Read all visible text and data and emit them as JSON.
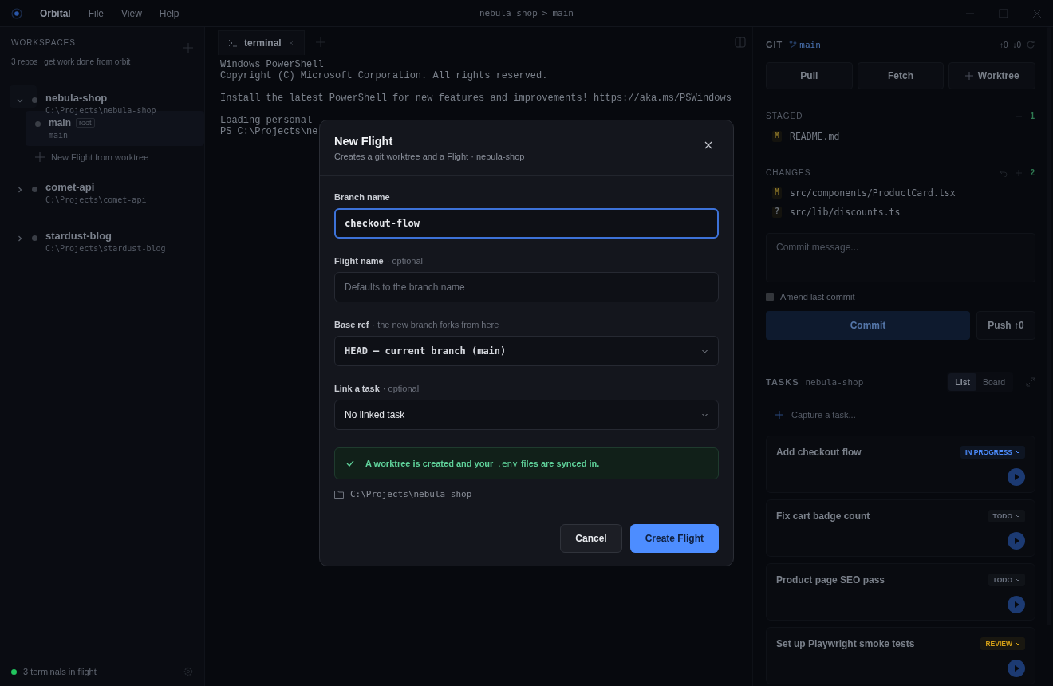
{
  "titlebar": {
    "app_name": "Orbital",
    "menu": [
      "File",
      "View",
      "Help"
    ],
    "repo": "nebula-shop",
    "separator": ">",
    "branch": "main"
  },
  "sidebar": {
    "heading": "WORKSPACES",
    "count": "3 repos",
    "tagline": "get work done from orbit",
    "workspaces": [
      {
        "name": "nebula-shop",
        "path": "C:\\Projects\\nebula-shop",
        "expanded": true,
        "children": [
          {
            "name": "main",
            "badge": "root",
            "branch": "main",
            "selected": true
          }
        ],
        "new_flight": "New Flight from worktree"
      },
      {
        "name": "comet-api",
        "path": "C:\\Projects\\comet-api",
        "expanded": false
      },
      {
        "name": "stardust-blog",
        "path": "C:\\Projects\\stardust-blog",
        "expanded": false
      }
    ],
    "footer": {
      "text": "3 terminals in flight",
      "color": "#22c55e"
    }
  },
  "terminal": {
    "tab": "terminal",
    "blocks": [
      [
        "Windows PowerShell",
        "Copyright (C) Microsoft Corporation. All rights reserved."
      ],
      [
        "Install the latest PowerShell for new features and improvements! https://aka.ms/PSWindows"
      ],
      [
        "Loading personal",
        "PS C:\\Projects\\ne"
      ]
    ]
  },
  "git": {
    "title": "GIT",
    "branch": "main",
    "ahead": "↑0",
    "behind": "↓0",
    "actions": [
      "Pull",
      "Fetch",
      "Worktree"
    ],
    "staged": {
      "label": "STAGED",
      "count": "1",
      "files": [
        {
          "status": "M",
          "path": "README.md"
        }
      ]
    },
    "changes": {
      "label": "CHANGES",
      "count": "2",
      "files": [
        {
          "status": "M",
          "path": "src/components/ProductCard.tsx"
        },
        {
          "status": "?",
          "path": "src/lib/discounts.ts"
        }
      ]
    },
    "commit_placeholder": "Commit message...",
    "amend": {
      "label": "Amend last commit",
      "checked": false
    },
    "commit_button": {
      "label": "Commit",
      "disabled": true
    },
    "push_button": "Push ↑0"
  },
  "tasks": {
    "title": "TASKS",
    "repo": "nebula-shop",
    "views": [
      {
        "label": "List",
        "selected": true
      },
      {
        "label": "Board",
        "selected": false
      }
    ],
    "capture_placeholder": "Capture a task...",
    "items": [
      {
        "title": "Add checkout flow",
        "status": "IN PROGRESS",
        "color": "#4d8dff"
      },
      {
        "title": "Fix cart badge count",
        "status": "TODO",
        "color": "#6b7280"
      },
      {
        "title": "Product page SEO pass",
        "status": "TODO",
        "color": "#6b7280"
      },
      {
        "title": "Set up Playwright smoke tests",
        "status": "REVIEW",
        "color": "#d4a017"
      }
    ]
  },
  "modal": {
    "title": "New Flight",
    "subtitle": "Creates a git worktree and a Flight · nebula-shop",
    "fields": [
      {
        "kind": "text",
        "label": "Branch name",
        "value": "checkout-flow",
        "focused": true
      },
      {
        "kind": "text",
        "label": "Flight name",
        "hint": "· optional",
        "placeholder": "Defaults to the branch name",
        "focused": false
      },
      {
        "kind": "select",
        "label": "Base ref",
        "hint": "· the new branch forks from here",
        "value": "HEAD — current branch (main)",
        "mono": true
      },
      {
        "kind": "select",
        "label": "Link a task",
        "hint": "· optional",
        "value": "No linked task",
        "mono": false
      }
    ],
    "notice": {
      "before": "A worktree is created and your",
      "code": ".env",
      "after": "files are synced in."
    },
    "path": "C:\\Projects\\nebula-shop",
    "buttons": [
      {
        "label": "Cancel",
        "kind": "secondary"
      },
      {
        "label": "Create Flight",
        "kind": "primary"
      }
    ]
  }
}
